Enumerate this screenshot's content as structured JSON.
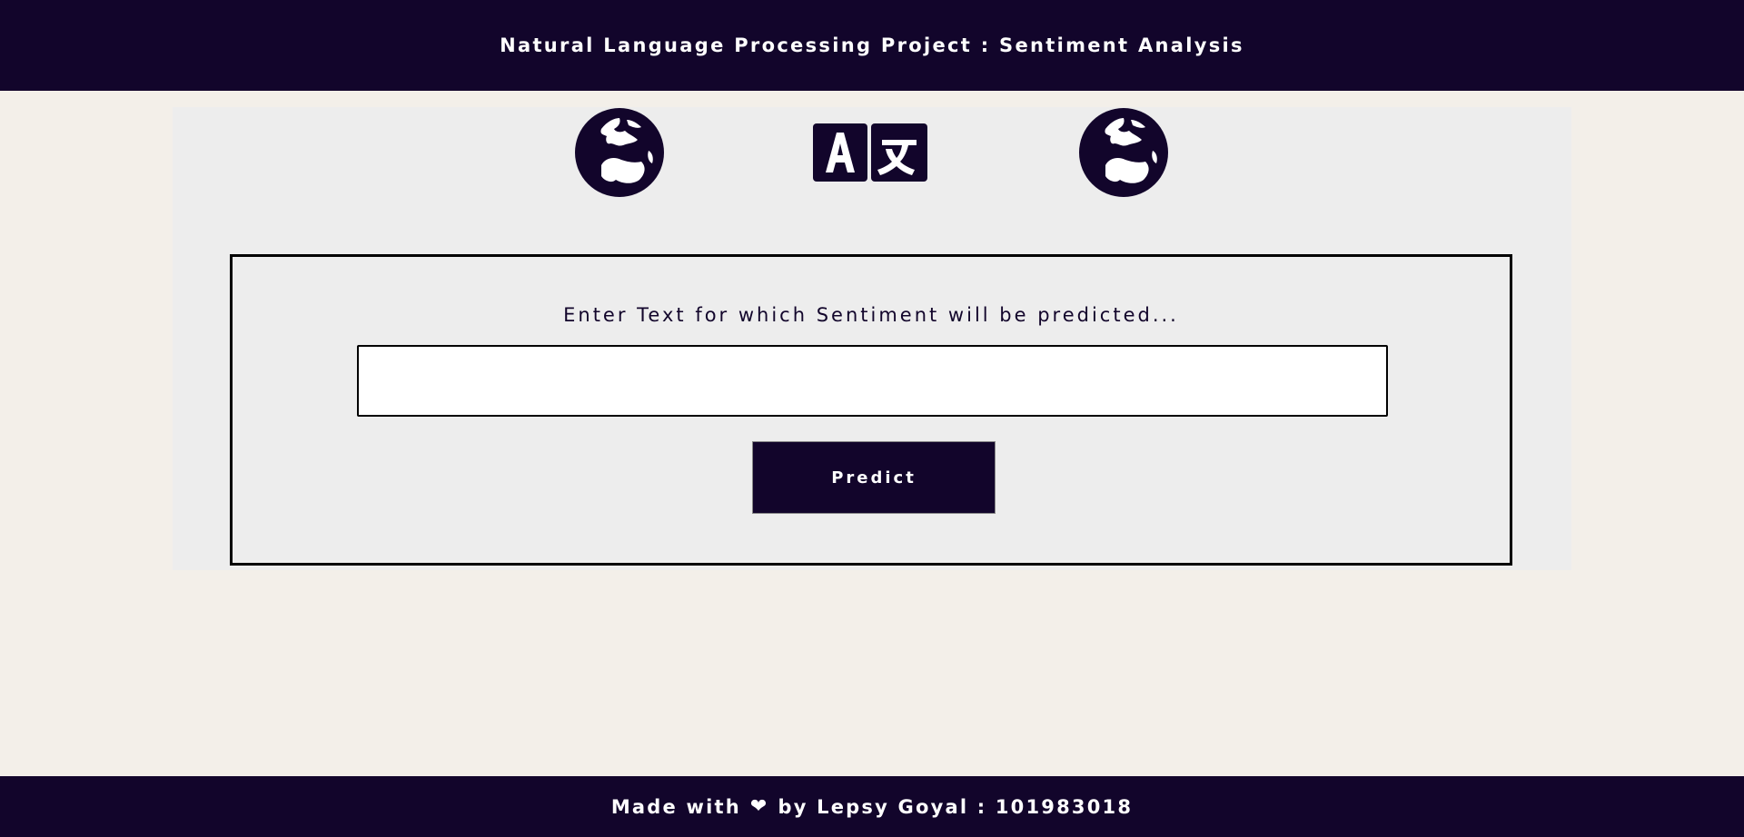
{
  "header": {
    "title": "Natural Language Processing Project : Sentiment Analysis"
  },
  "icons": {
    "left": "globe-icon",
    "center": "translate-icon",
    "right": "globe-icon"
  },
  "form": {
    "prompt": "Enter Text for which Sentiment will be predicted...",
    "input_value": "",
    "input_placeholder": "",
    "button_label": "Predict"
  },
  "footer": {
    "prefix": "Made with",
    "heart": "❤",
    "suffix": "by Lepsy Goyal : 101983018"
  },
  "colors": {
    "primary": "#12052b",
    "background": "#f3efe9",
    "panel": "#ededed"
  }
}
